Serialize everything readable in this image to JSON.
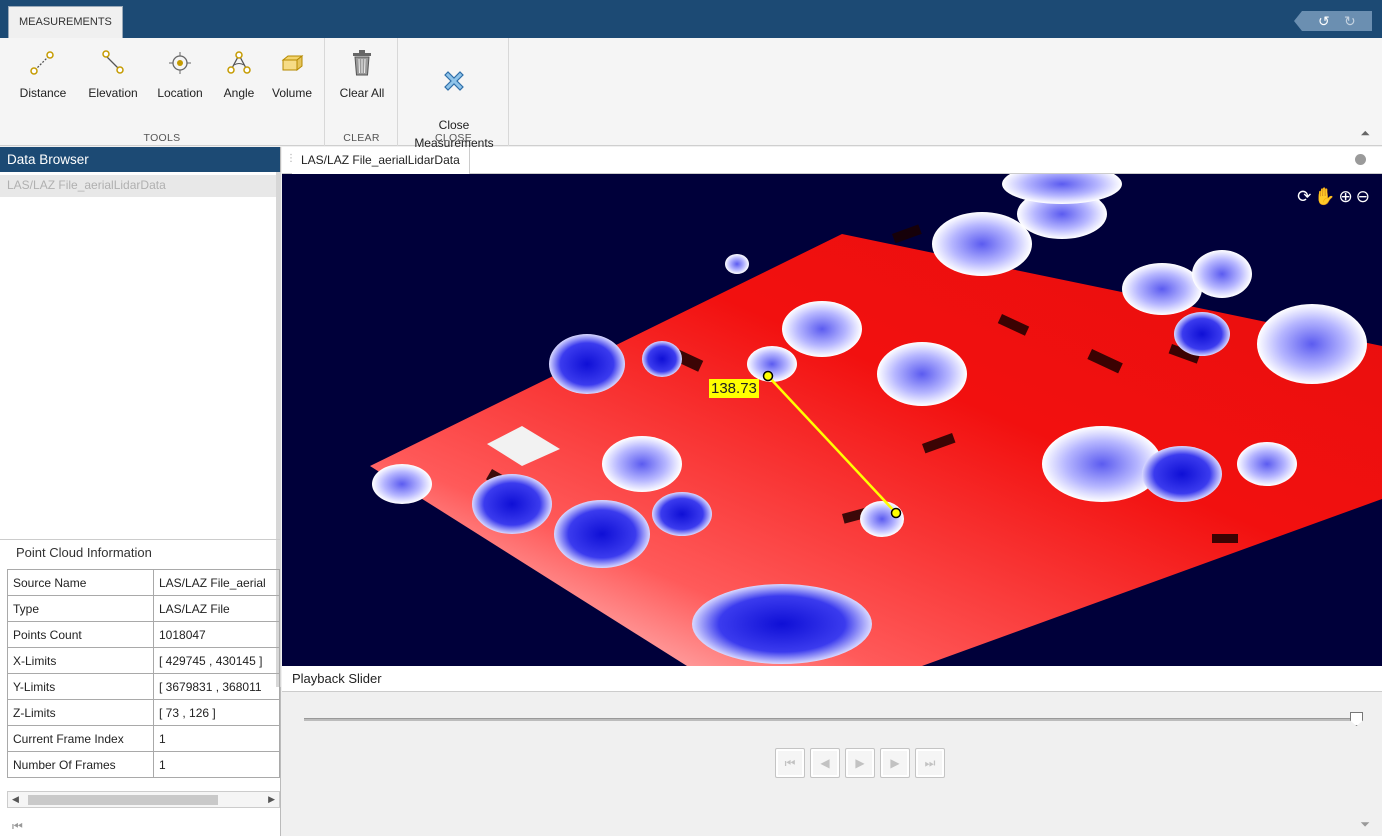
{
  "tabs": {
    "active": "MEASUREMENTS"
  },
  "quick_access": {
    "undo_icon": "↺",
    "redo_icon": "↻"
  },
  "ribbon": {
    "groups": [
      {
        "label": "TOOLS",
        "tools": [
          "Distance",
          "Elevation",
          "Location",
          "Angle",
          "Volume"
        ]
      },
      {
        "label": "CLEAR",
        "tools": [
          "Clear All"
        ]
      },
      {
        "label": "CLOSE",
        "tools": [
          "Close\nMeasurements"
        ]
      }
    ],
    "icons": [
      "distance-icon",
      "elevation-icon",
      "location-icon",
      "angle-icon",
      "volume-icon",
      "trash-icon",
      "close-x-icon"
    ]
  },
  "data_browser": {
    "header": "Data Browser",
    "items": [
      "LAS/LAZ File_aerialLidarData"
    ]
  },
  "point_cloud_info": {
    "header": "Point Cloud Information",
    "rows": [
      [
        "Source Name",
        "LAS/LAZ File_aerial"
      ],
      [
        "Type",
        "LAS/LAZ File"
      ],
      [
        "Points Count",
        "1018047"
      ],
      [
        "X-Limits",
        "[ 429745 , 430145 ]"
      ],
      [
        "Y-Limits",
        "[ 3679831 , 368011"
      ],
      [
        "Z-Limits",
        "[ 73 , 126 ]"
      ],
      [
        "Current Frame Index",
        "1"
      ],
      [
        "Number Of Frames",
        "1"
      ]
    ]
  },
  "document": {
    "tab": "LAS/LAZ File_aerialLidarData",
    "measurement_value": "138.73",
    "toolbar_icons": [
      "rotate-icon",
      "pan-hand-icon",
      "zoom-in-icon",
      "zoom-out-icon"
    ]
  },
  "playback": {
    "header": "Playback Slider",
    "slider_fraction": 1.0,
    "buttons": [
      "first-frame",
      "previous-frame",
      "play",
      "next-frame",
      "last-frame"
    ]
  },
  "colors": {
    "brand_blue": "#1c4a74",
    "viewer_bg": "#00003a",
    "ground_red": "#f2100f",
    "tree_blue": "#1a1ad8",
    "measure_yellow": "#ffff00"
  }
}
